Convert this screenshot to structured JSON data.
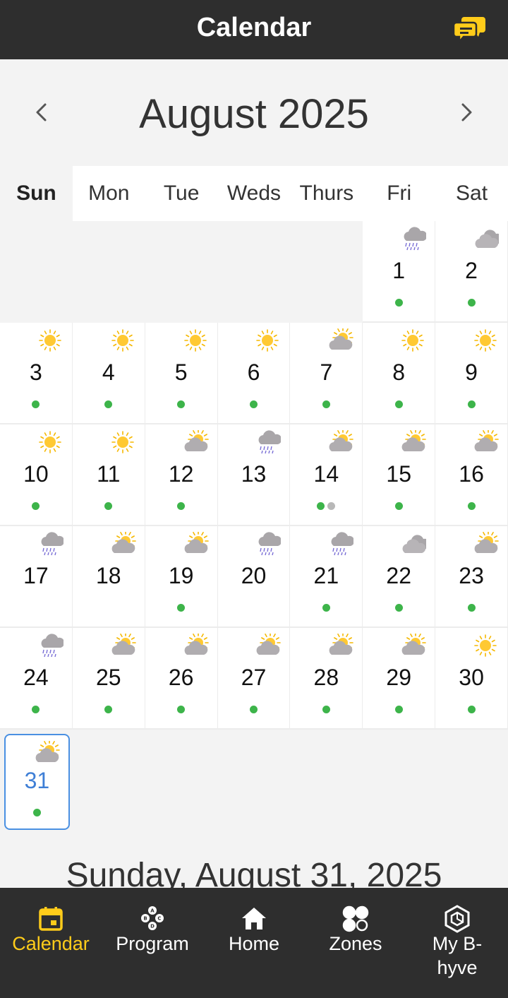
{
  "header": {
    "title": "Calendar",
    "chat_icon": "chat-bubbles-icon",
    "accent": "#ffcc1a"
  },
  "nav": {
    "month_title": "August 2025",
    "prev_icon": "chevron-left-icon",
    "next_icon": "chevron-right-icon"
  },
  "weekdays": [
    "Sun",
    "Mon",
    "Tue",
    "Weds",
    "Thurs",
    "Fri",
    "Sat"
  ],
  "active_weekday": "Sun",
  "days": [
    {
      "day": "1",
      "weather": "rain",
      "dots": [
        "green"
      ]
    },
    {
      "day": "2",
      "weather": "cloudy",
      "dots": [
        "green"
      ]
    },
    {
      "day": "3",
      "weather": "sunny",
      "dots": [
        "green"
      ]
    },
    {
      "day": "4",
      "weather": "sunny",
      "dots": [
        "green"
      ]
    },
    {
      "day": "5",
      "weather": "sunny",
      "dots": [
        "green"
      ]
    },
    {
      "day": "6",
      "weather": "sunny",
      "dots": [
        "green"
      ]
    },
    {
      "day": "7",
      "weather": "partly-cloudy",
      "dots": [
        "green"
      ]
    },
    {
      "day": "8",
      "weather": "sunny",
      "dots": [
        "green"
      ]
    },
    {
      "day": "9",
      "weather": "sunny",
      "dots": [
        "green"
      ]
    },
    {
      "day": "10",
      "weather": "sunny",
      "dots": [
        "green"
      ]
    },
    {
      "day": "11",
      "weather": "sunny",
      "dots": [
        "green"
      ]
    },
    {
      "day": "12",
      "weather": "partly-cloudy",
      "dots": [
        "green"
      ]
    },
    {
      "day": "13",
      "weather": "rain",
      "dots": []
    },
    {
      "day": "14",
      "weather": "partly-cloudy",
      "dots": [
        "green",
        "gray"
      ]
    },
    {
      "day": "15",
      "weather": "partly-cloudy",
      "dots": [
        "green"
      ]
    },
    {
      "day": "16",
      "weather": "partly-cloudy",
      "dots": [
        "green"
      ]
    },
    {
      "day": "17",
      "weather": "rain",
      "dots": []
    },
    {
      "day": "18",
      "weather": "partly-cloudy",
      "dots": []
    },
    {
      "day": "19",
      "weather": "partly-cloudy",
      "dots": [
        "green"
      ]
    },
    {
      "day": "20",
      "weather": "rain",
      "dots": []
    },
    {
      "day": "21",
      "weather": "rain",
      "dots": [
        "green"
      ]
    },
    {
      "day": "22",
      "weather": "cloudy",
      "dots": [
        "green"
      ]
    },
    {
      "day": "23",
      "weather": "partly-cloudy",
      "dots": [
        "green"
      ]
    },
    {
      "day": "24",
      "weather": "rain",
      "dots": [
        "green"
      ]
    },
    {
      "day": "25",
      "weather": "partly-cloudy",
      "dots": [
        "green"
      ]
    },
    {
      "day": "26",
      "weather": "partly-cloudy",
      "dots": [
        "green"
      ]
    },
    {
      "day": "27",
      "weather": "partly-cloudy",
      "dots": [
        "green"
      ]
    },
    {
      "day": "28",
      "weather": "partly-cloudy",
      "dots": [
        "green"
      ]
    },
    {
      "day": "29",
      "weather": "partly-cloudy",
      "dots": [
        "green"
      ]
    },
    {
      "day": "30",
      "weather": "sunny",
      "dots": [
        "green"
      ]
    },
    {
      "day": "31",
      "weather": "partly-cloudy",
      "dots": [
        "green"
      ],
      "selected": true
    }
  ],
  "first_weekday_index": 5,
  "selected_date_label": "Sunday, August 31, 2025",
  "tabs": [
    {
      "label": "Calendar",
      "icon": "calendar-icon",
      "active": true
    },
    {
      "label": "Program",
      "icon": "program-icon",
      "active": false
    },
    {
      "label": "Home",
      "icon": "home-icon",
      "active": false
    },
    {
      "label": "Zones",
      "icon": "zones-icon",
      "active": false
    },
    {
      "label": "My B-\nhyve",
      "icon": "hexagon-device-icon",
      "active": false
    }
  ],
  "colors": {
    "selected_border": "#4a90e2",
    "dot_green": "#3db44a",
    "dot_gray": "#b8b8b8",
    "bar_bg": "#2e2e2e"
  }
}
